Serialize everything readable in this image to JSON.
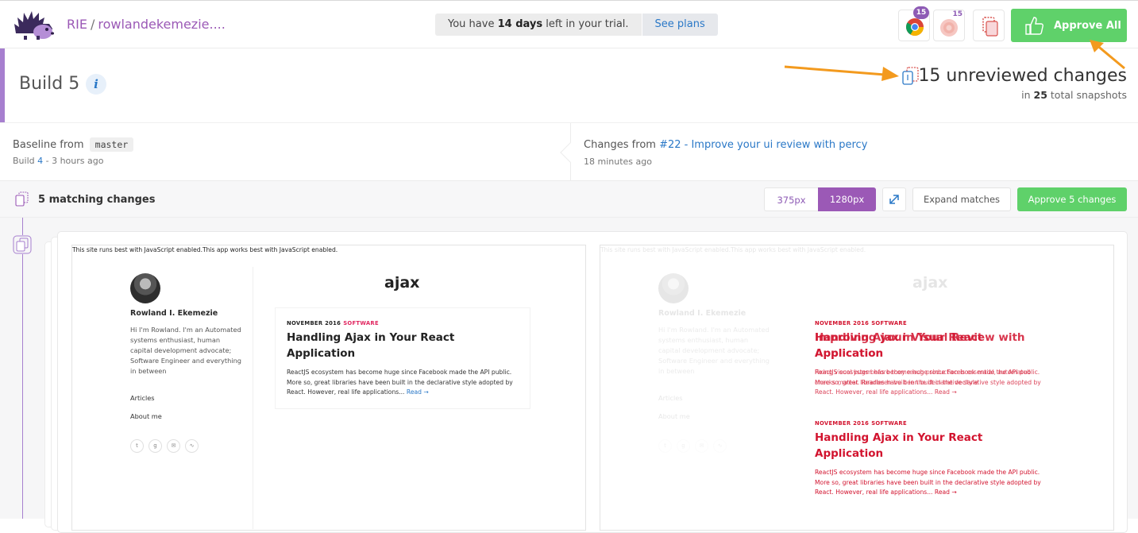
{
  "header": {
    "org": "RIE",
    "separator": "/",
    "project": "rowlandekemezie....",
    "trial_prefix": "You have ",
    "trial_days": "14 days",
    "trial_suffix": " left in your trial.",
    "see_plans": "See plans",
    "chrome_count": "15",
    "firefox_count": "15",
    "approve_all": "Approve All"
  },
  "build": {
    "title": "Build 5",
    "info": "i",
    "unreviewed": "15 unreviewed changes",
    "snap_prefix": "in ",
    "snap_count": "25",
    "snap_suffix": " total snapshots"
  },
  "baseline": {
    "label": "Baseline from",
    "branch": "master",
    "build_prefix": "Build ",
    "build_num": "4",
    "build_suffix": " - 3 hours ago",
    "changes_label": "Changes from",
    "changes_link": "#22 - Improve your ui review with percy",
    "changes_time": "18 minutes ago"
  },
  "group": {
    "title": "5 matching changes",
    "w375": "375px",
    "w1280": "1280px",
    "expand": "Expand matches",
    "approve": "Approve 5 changes"
  },
  "snapshot": {
    "noscript": "This site runs best with JavaScript enabled.This app works best with JavaScript enabled.",
    "site_title": "ajax",
    "author": "Rowland I. Ekemezie",
    "bio": "Hi I'm Rowland. I'm an Automated systems enthusiast, human capital development advocate; Software Engineer and everything in between",
    "nav_articles": "Articles",
    "nav_about": "About me",
    "post_date": "NOVEMBER 2016",
    "post_tag": "SOFTWARE",
    "post_title": "Handling Ajax in Your React Application",
    "post_excerpt": "ReactJS ecosystem has become huge since Facebook made the API public. More so, great libraries have been built in the declarative style adopted by React. However, real life applications...",
    "read_more": "Read →",
    "diff_title_overlay": "Improving your Visual Review with Application",
    "diff_excerpt_overlay": "Fixing visual bugs before they reach production is essential, automated checks matter. Readbeen built in the declarative style"
  },
  "colors": {
    "brand_purple": "#9b59b6",
    "approve_green": "#5fd16a",
    "link_blue": "#2a78c7",
    "diff_red": "#d2132e",
    "annotation_orange": "#f39a1e"
  }
}
